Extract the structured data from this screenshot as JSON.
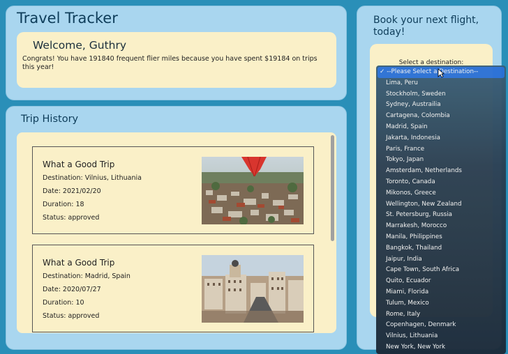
{
  "header": {
    "title": "Travel Tracker",
    "welcome": "Welcome, Guthry",
    "message": "Congrats! You have 191840 frequent flier miles because you have spent $19184 on trips this year!"
  },
  "history": {
    "title": "Trip History",
    "trips": [
      {
        "name": "What a Good Trip",
        "destination": "Destination: Vilnius, Lithuania",
        "date": "Date: 2021/02/20",
        "duration": "Duration: 18",
        "status": "Status: approved"
      },
      {
        "name": "What a Good Trip",
        "destination": "Destination: Madrid, Spain",
        "date": "Date: 2020/07/27",
        "duration": "Duration: 10",
        "status": "Status: approved"
      }
    ]
  },
  "booking": {
    "title": "Book your next flight, today!",
    "select_label": "Select a destination:",
    "options": [
      "--Please Select a Destination--",
      "Lima, Peru",
      "Stockholm, Sweden",
      "Sydney, Austrailia",
      "Cartagena, Colombia",
      "Madrid, Spain",
      "Jakarta, Indonesia",
      "Paris, France",
      "Tokyo, Japan",
      "Amsterdam, Netherlands",
      "Toronto, Canada",
      "Mikonos, Greece",
      "Wellington, New Zealand",
      "St. Petersburg, Russia",
      "Marrakesh, Morocco",
      "Manila, Philippines",
      "Bangkok, Thailand",
      "Jaipur, India",
      "Cape Town, South Africa",
      "Quito, Ecuador",
      "Miami, Florida",
      "Tulum, Mexico",
      "Rome, Italy",
      "Copenhagen, Denmark",
      "Vilnius, Lithuania",
      "New York, New York"
    ],
    "checkmark": "✓"
  }
}
